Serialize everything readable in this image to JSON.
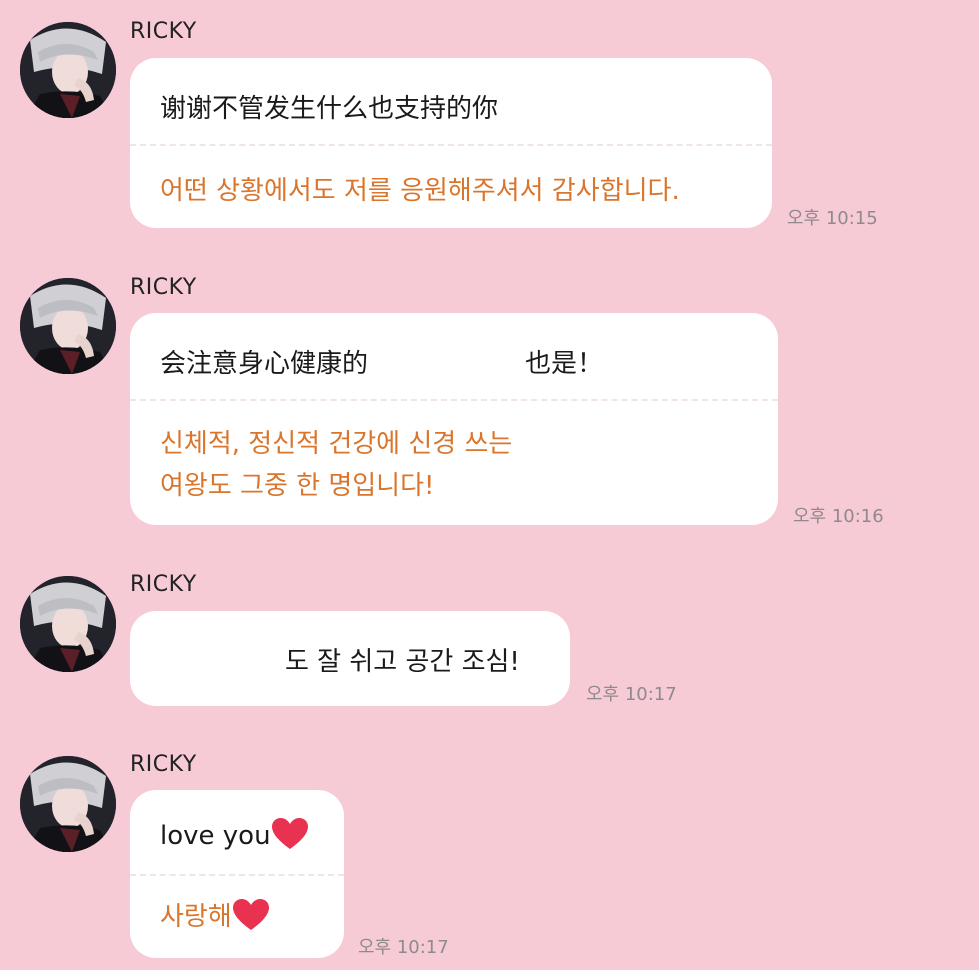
{
  "messages": [
    {
      "sender": "RICKY",
      "cn": "谢谢不管发生什么也支持的你",
      "kr": [
        "어떤 상황에서도 저를 응원해주셔서 감사합니다."
      ],
      "time": "오후 10:15"
    },
    {
      "sender": "RICKY",
      "cn_left": "会注意身心健康的",
      "cn_right": "也是！",
      "kr": [
        "신체적, 정신적 건강에 신경 쓰는",
        "여왕도 그중 한 명입니다!"
      ],
      "time": "오후 10:16"
    },
    {
      "sender": "RICKY",
      "text": "도 잘 쉬고 공간 조심!",
      "time": "오후 10:17"
    },
    {
      "sender": "RICKY",
      "en": "love you",
      "kr": [
        "사랑해"
      ],
      "time": "오후 10:17",
      "heart_color": "#e8324f"
    }
  ]
}
